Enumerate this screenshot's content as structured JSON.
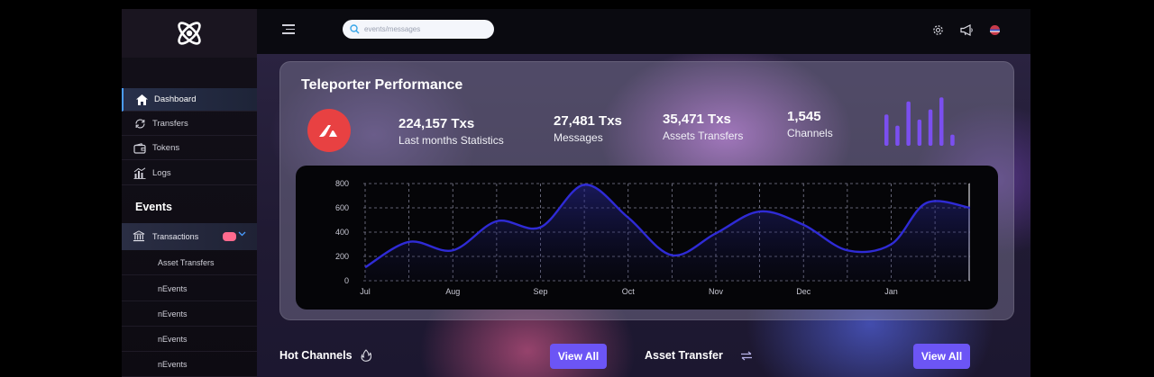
{
  "topbar": {
    "search_placeholder": "events/messages",
    "icons": [
      "menu-icon",
      "search-icon",
      "gear-icon",
      "megaphone-icon",
      "language-icon"
    ]
  },
  "sidebar": {
    "nav": [
      {
        "label": "Dashboard",
        "icon": "home-icon",
        "active": true
      },
      {
        "label": "Transfers",
        "icon": "refresh-icon"
      },
      {
        "label": "Tokens",
        "icon": "wallet-icon"
      },
      {
        "label": "Logs",
        "icon": "bar-chart-icon"
      }
    ],
    "events_title": "Events",
    "transactions_label": "Transactions",
    "sub_items": [
      "Asset Transfers",
      "nEvents",
      "nEvents",
      "nEvents",
      "nEvents"
    ]
  },
  "card": {
    "title": "Teleporter Performance",
    "stats": [
      {
        "value": "224,157 Txs",
        "label": "Last months Statistics"
      },
      {
        "value": "27,481 Txs",
        "label": "Messages"
      },
      {
        "value": "35,471 Txs",
        "label": "Assets Transfers"
      },
      {
        "value": "1,545",
        "label": "Channels"
      }
    ],
    "mini_bars": [
      0.62,
      0.4,
      0.88,
      0.52,
      0.72,
      0.96,
      0.22
    ]
  },
  "chart_data": {
    "type": "line",
    "categories": [
      "Jul",
      "Aug",
      "Sep",
      "Oct",
      "Nov",
      "Dec",
      "Jan"
    ],
    "x": [
      0,
      0.5,
      1,
      1.5,
      2,
      2.5,
      3,
      3.5,
      4,
      4.5,
      5,
      5.5,
      6,
      6.4,
      6.9
    ],
    "values": [
      110,
      320,
      250,
      490,
      440,
      790,
      520,
      210,
      390,
      570,
      460,
      250,
      300,
      640,
      600
    ],
    "ylim": [
      0,
      800
    ],
    "yticks": [
      0,
      200,
      400,
      600,
      800
    ],
    "grid": true,
    "color": "#2f2bd6"
  },
  "bottom": {
    "hot_channels": "Hot Channels",
    "asset_transfer": "Asset Transfer",
    "view_all_1": "View All",
    "view_all_2": "View All"
  },
  "colors": {
    "accent": "#6c55f5",
    "avax_red": "#e84142",
    "bar_purple": "#7b4ff0",
    "line_blue": "#2f2bd6"
  }
}
